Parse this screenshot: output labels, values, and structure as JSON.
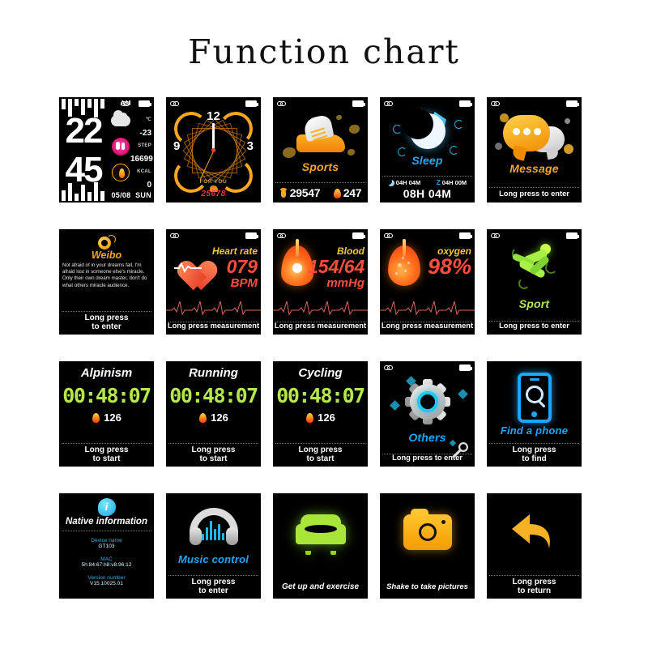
{
  "page": {
    "title": "Function chart"
  },
  "cards": [
    {
      "name": "watch-face-digital",
      "time_hour": "22",
      "time_min": "45",
      "meridiem": "AM",
      "temp_unit": "℃",
      "temp_value": "-23",
      "step_label": "STEP",
      "step_value": "16699",
      "kcal_label": "KCAL",
      "kcal_value": "0",
      "date": "05/08",
      "weekday": "SUN"
    },
    {
      "name": "watch-face-analog",
      "num12": "12",
      "num9": "9",
      "num3": "3",
      "tagline": "FOR YOU",
      "steps": "25678"
    },
    {
      "name": "sports",
      "label": "Sports",
      "steps": "29547",
      "calories": "247"
    },
    {
      "name": "sleep",
      "label": "Sleep",
      "deep": "04H 04M",
      "light": "04H 00M",
      "total": "08H 04M",
      "zzz": "Z"
    },
    {
      "name": "message",
      "label": "Message",
      "hint": "Long press to enter"
    },
    {
      "name": "weibo",
      "label": "Weibo",
      "body": "Not afraid of in your dreams fall, I'm afraid lost in someone else's miracle. Only their own dream master, don't do what others miracle audience.",
      "hint_line1": "Long press",
      "hint_line2": "to enter"
    },
    {
      "name": "heart-rate",
      "label": "Heart rate",
      "value": "079",
      "unit": "BPM",
      "hint": "Long press measurement"
    },
    {
      "name": "blood-pressure",
      "label": "Blood",
      "value": "154/64",
      "unit": "mmHg",
      "hint": "Long press measurement"
    },
    {
      "name": "blood-oxygen",
      "label": "oxygen",
      "value": "98%",
      "hint": "Long press measurement"
    },
    {
      "name": "sport",
      "label": "Sport",
      "hint": "Long press to enter"
    },
    {
      "name": "alpinism",
      "label": "Alpinism",
      "timer": "00:48:07",
      "calories": "126",
      "hint_line1": "Long press",
      "hint_line2": "to start"
    },
    {
      "name": "running",
      "label": "Running",
      "timer": "00:48:07",
      "calories": "126",
      "hint_line1": "Long press",
      "hint_line2": "to start"
    },
    {
      "name": "cycling",
      "label": "Cycling",
      "timer": "00:48:07",
      "calories": "126",
      "hint_line1": "Long press",
      "hint_line2": "to start"
    },
    {
      "name": "others",
      "label": "Others",
      "hint": "Long press to enter"
    },
    {
      "name": "find-a-phone",
      "label": "Find a phone",
      "hint_line1": "Long press",
      "hint_line2": "to find"
    },
    {
      "name": "native-information",
      "label": "Native information",
      "device_name_key": "Device name",
      "device_name_value": "GT103",
      "mac_key": "MAC",
      "mac_value": "5h:84:67:h8:v8:96:12",
      "version_key": "Version number",
      "version_value": "V15.10025.01"
    },
    {
      "name": "music-control",
      "label": "Music control",
      "hint_line1": "Long press",
      "hint_line2": "to enter"
    },
    {
      "name": "sedentary-reminder",
      "hint": "Get up and exercise"
    },
    {
      "name": "camera-shake",
      "hint": "Shake to take pictures"
    },
    {
      "name": "back",
      "hint_line1": "Long press",
      "hint_line2": "to return"
    }
  ],
  "colors": {
    "orange": "#f5a623",
    "green": "#b4e84c",
    "blue": "#19a8ff",
    "red": "#ff4d3d",
    "pink": "#e5147c",
    "background": "#ffffff",
    "card_bg": "#000000"
  }
}
